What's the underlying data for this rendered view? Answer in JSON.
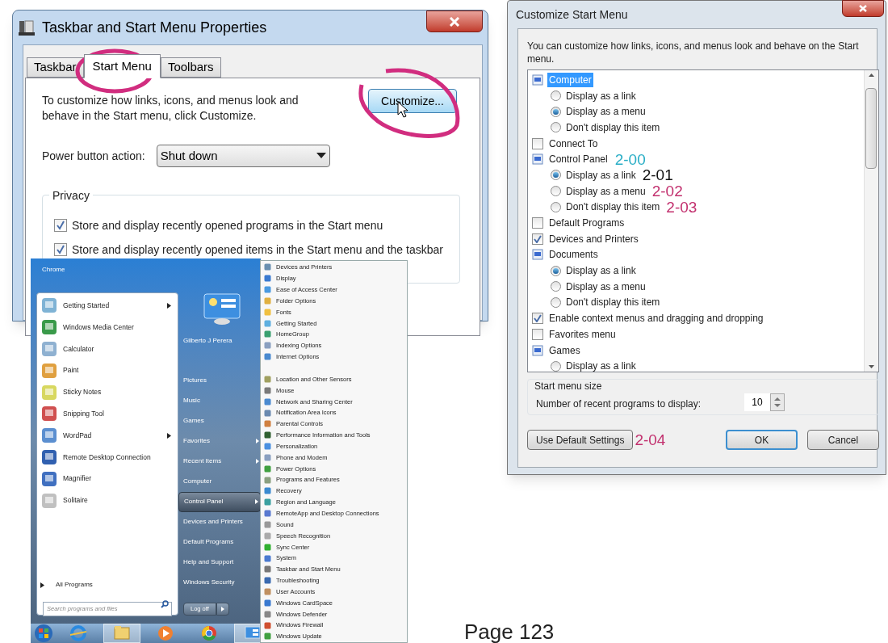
{
  "taskbar_properties": {
    "title": "Taskbar and Start Menu Properties",
    "tabs": [
      {
        "label": "Taskbar",
        "selected": false
      },
      {
        "label": "Start Menu",
        "selected": true
      },
      {
        "label": "Toolbars",
        "selected": false
      }
    ],
    "description": "To customize how links, icons, and menus look and behave in the Start menu, click Customize.",
    "customize_button": "Customize...",
    "power_button_action": {
      "label": "Power button action:",
      "value": "Shut down"
    },
    "privacy": {
      "title": "Privacy",
      "options": [
        {
          "label": "Store and display recently opened programs in the Start menu",
          "checked": true
        },
        {
          "label": "Store and display recently opened items in the Start menu and the taskbar",
          "checked": true
        }
      ]
    }
  },
  "start_menu": {
    "pinned_header": "Chrome",
    "programs": [
      {
        "label": "Getting Started",
        "submenu": true
      },
      {
        "label": "Windows Media Center",
        "submenu": false
      },
      {
        "label": "Calculator",
        "submenu": false
      },
      {
        "label": "Paint",
        "submenu": false
      },
      {
        "label": "Sticky Notes",
        "submenu": false
      },
      {
        "label": "Snipping Tool",
        "submenu": false
      },
      {
        "label": "WordPad",
        "submenu": true
      },
      {
        "label": "Remote Desktop Connection",
        "submenu": false
      },
      {
        "label": "Magnifier",
        "submenu": false
      },
      {
        "label": "Solitaire",
        "submenu": false
      }
    ],
    "all_programs": "All Programs",
    "search": {
      "placeholder": "Search programs and files"
    },
    "user_name": "Gilberto J Perera",
    "places": [
      {
        "label": "Pictures",
        "submenu": false,
        "selected": false
      },
      {
        "label": "Music",
        "submenu": false,
        "selected": false
      },
      {
        "label": "Games",
        "submenu": false,
        "selected": false
      },
      {
        "label": "Favorites",
        "submenu": true,
        "selected": false
      },
      {
        "label": "Recent Items",
        "submenu": true,
        "selected": false
      },
      {
        "label": "Computer",
        "submenu": false,
        "selected": false
      },
      {
        "label": "Control Panel",
        "submenu": true,
        "selected": true
      },
      {
        "label": "Devices and Printers",
        "submenu": false,
        "selected": false
      },
      {
        "label": "Default Programs",
        "submenu": false,
        "selected": false
      },
      {
        "label": "Help and Support",
        "submenu": false,
        "selected": false
      },
      {
        "label": "Windows Security",
        "submenu": false,
        "selected": false
      }
    ],
    "log_off": "Log off"
  },
  "control_panel_menu": [
    "Devices and Printers",
    "Display",
    "Ease of Access Center",
    "Folder Options",
    "Fonts",
    "Getting Started",
    "HomeGroup",
    "Indexing Options",
    "Internet Options",
    "Location and Other Sensors",
    "Mouse",
    "Network and Sharing Center",
    "Notification Area Icons",
    "Parental Controls",
    "Performance Information and Tools",
    "Personalization",
    "Phone and Modem",
    "Power Options",
    "Programs and Features",
    "Recovery",
    "Region and Language",
    "RemoteApp and Desktop Connections",
    "Sound",
    "Speech Recognition",
    "Sync Center",
    "System",
    "Taskbar and Start Menu",
    "Troubleshooting",
    "User Accounts",
    "Windows CardSpace",
    "Windows Defender",
    "Windows Firewall",
    "Windows Update"
  ],
  "customize_start_menu": {
    "title": "Customize Start Menu",
    "description": "You can customize how links, icons, and menus look and behave on the Start menu.",
    "tree": [
      {
        "kind": "group",
        "label": "Computer",
        "selected": true,
        "children": [
          {
            "label": "Display as a link",
            "checked": false
          },
          {
            "label": "Display as a menu",
            "checked": true
          },
          {
            "label": "Don't display this item",
            "checked": false
          }
        ]
      },
      {
        "kind": "checkbox",
        "label": "Connect To",
        "checked": false,
        "selected": false
      },
      {
        "kind": "group",
        "label": "Control Panel",
        "selected": false,
        "annotation": {
          "text": "2-00",
          "color": "#2aaec6"
        },
        "children": [
          {
            "label": "Display as a link",
            "checked": true,
            "annotation": {
              "text": "2-01",
              "color": "#111111"
            }
          },
          {
            "label": "Display as a menu",
            "checked": false,
            "annotation": {
              "text": "2-02",
              "color": "#c2306e"
            }
          },
          {
            "label": "Don't display this item",
            "checked": false,
            "annotation": {
              "text": "2-03",
              "color": "#c2306e"
            }
          }
        ]
      },
      {
        "kind": "checkbox",
        "label": "Default Programs",
        "checked": false,
        "selected": false
      },
      {
        "kind": "checkbox",
        "label": "Devices and Printers",
        "checked": true,
        "selected": false
      },
      {
        "kind": "group",
        "label": "Documents",
        "selected": false,
        "children": [
          {
            "label": "Display as a link",
            "checked": true
          },
          {
            "label": "Display as a menu",
            "checked": false
          },
          {
            "label": "Don't display this item",
            "checked": false
          }
        ]
      },
      {
        "kind": "checkbox",
        "label": "Enable context menus and dragging and dropping",
        "checked": true,
        "selected": false
      },
      {
        "kind": "checkbox",
        "label": "Favorites menu",
        "checked": false,
        "selected": false
      },
      {
        "kind": "group",
        "label": "Games",
        "selected": false,
        "children": [
          {
            "label": "Display as a link",
            "checked": false
          }
        ]
      }
    ],
    "size_group": {
      "title": "Start menu size",
      "label": "Number of recent programs to display:",
      "value": "10"
    },
    "buttons": [
      {
        "label": "Use Default Settings",
        "default": false,
        "annotation": {
          "text": "2-04",
          "color": "#c2306e"
        }
      },
      {
        "label": "OK",
        "default": true
      },
      {
        "label": "Cancel",
        "default": false
      }
    ]
  },
  "page_number": "Page 123"
}
